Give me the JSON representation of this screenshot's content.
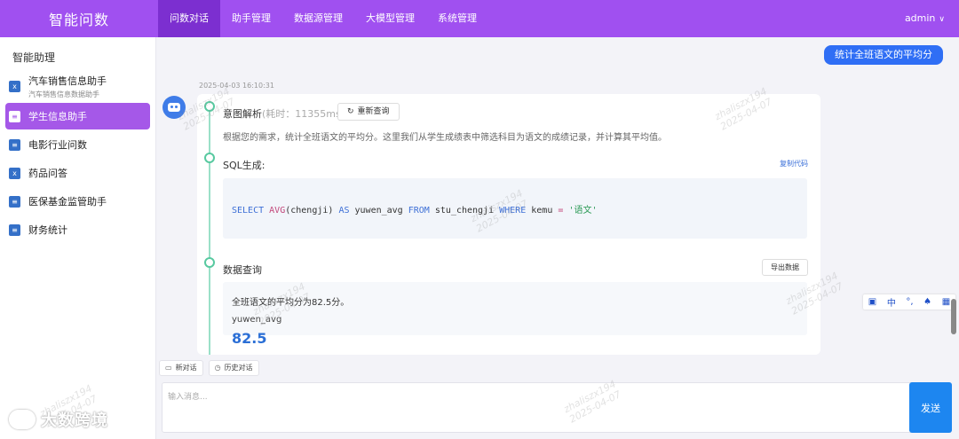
{
  "app": {
    "title": "智能问数",
    "user": "admin"
  },
  "nav": [
    "问数对话",
    "助手管理",
    "数据源管理",
    "大模型管理",
    "系统管理"
  ],
  "sidebar": {
    "title": "智能助理",
    "items": [
      {
        "label": "汽车销售信息助手",
        "sub": "汽车销售信息数据助手"
      },
      {
        "label": "学生信息助手"
      },
      {
        "label": "电影行业问数"
      },
      {
        "label": "药品问答"
      },
      {
        "label": "医保基金监管助手"
      },
      {
        "label": "财务统计"
      }
    ]
  },
  "chat": {
    "user_message": "统计全班语文的平均分",
    "timestamp": "2025-04-03 16:10:31",
    "intent": {
      "title": "意图解析",
      "elapsed": "(耗时：11355ms)",
      "requery_label": "重新查询",
      "text": "根据您的需求，统计全班语文的平均分。这里我们从学生成绩表中筛选科目为语文的成绩记录，并计算其平均值。"
    },
    "sql": {
      "title": "SQL生成:",
      "copy_label": "复制代码",
      "tokens": {
        "select": "SELECT",
        "avg": "AVG",
        "arg": "(chengji)",
        "as": "AS",
        "alias": "yuwen_avg",
        "from": "FROM",
        "table": "stu_chengji",
        "where": "WHERE",
        "col": "kemu",
        "eq": "=",
        "value": "'语文'"
      }
    },
    "query": {
      "title": "数据查询",
      "export_label": "导出数据",
      "summary": "全班语文的平均分为82.5分。",
      "column": "yuwen_avg",
      "value": "82.5"
    }
  },
  "input": {
    "new_chat": "新对话",
    "history": "历史对话",
    "placeholder": "输入消息...",
    "send": "发送"
  },
  "float_bar": [
    "中",
    "°,"
  ],
  "watermark": {
    "name": "zhaliszx194",
    "date": "2025-04-07",
    "logo_text": "大数跨境"
  },
  "colors": {
    "primary": "#a050f0",
    "nav_active": "#7c2fd0",
    "send": "#1d86f0",
    "user_bubble": "#2f6ef5",
    "timeline": "#58c9a0"
  }
}
